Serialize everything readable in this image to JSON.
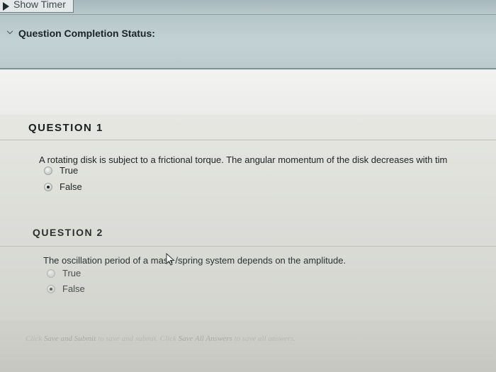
{
  "timer": {
    "label": "Show Timer"
  },
  "status": {
    "label": "Question Completion Status:"
  },
  "questions": [
    {
      "title": "QUESTION 1",
      "text": "A rotating disk is subject to a frictional torque. The angular momentum of the disk decreases with tim",
      "options": [
        {
          "label": "True",
          "selected": false
        },
        {
          "label": "False",
          "selected": true
        }
      ]
    },
    {
      "title": "QUESTION 2",
      "text": "The oscillation period of a mass /spring system depends on the amplitude.",
      "options": [
        {
          "label": "True",
          "selected": false
        },
        {
          "label": "False",
          "selected": true
        }
      ]
    }
  ],
  "footer": {
    "part1": "Click ",
    "save_and_submit": "Save and Submit",
    "part2": " to save and submit. Click ",
    "save_all_answers": "Save All Answers",
    "part3": " to save all answers."
  },
  "icons": {
    "timer": "play-icon",
    "status": "chevron-down-icon",
    "cursor": "mouse-pointer-icon"
  }
}
